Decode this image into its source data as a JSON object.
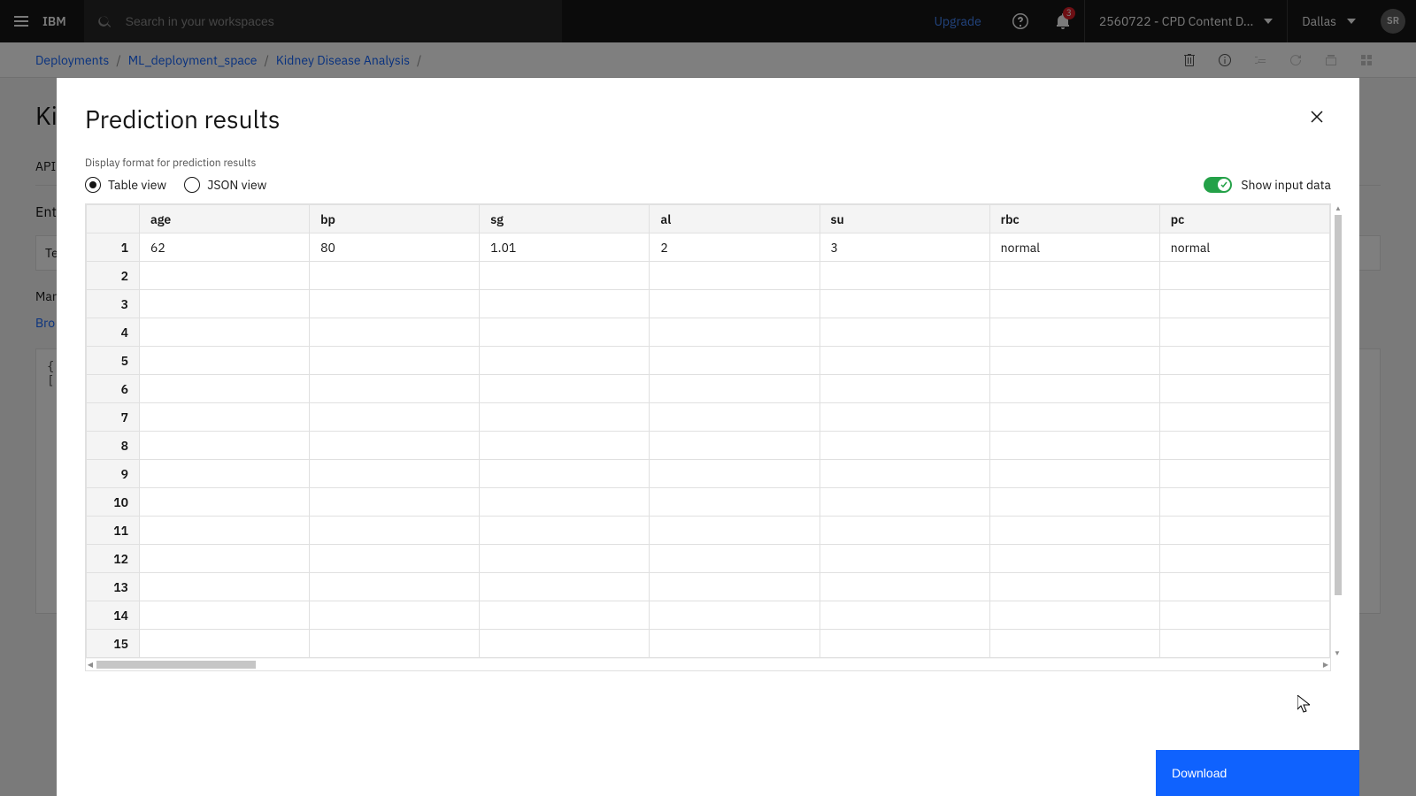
{
  "topbar": {
    "brand": "IBM",
    "search_placeholder": "Search in your workspaces",
    "upgrade": "Upgrade",
    "notif_count": "3",
    "project": "2560722 - CPD Content D...",
    "region": "Dallas",
    "avatar": "SR"
  },
  "breadcrumb": {
    "items": [
      "Deployments",
      "ML_deployment_space",
      "Kidney Disease Analysis"
    ]
  },
  "page": {
    "title_partial": "Ki",
    "tab_partial": "API",
    "enter_partial": "Ente",
    "tex": "Tex",
    "manual": "Mar",
    "browse": "Bro",
    "code1": "{",
    "code2": "["
  },
  "modal": {
    "title": "Prediction results",
    "format_label": "Display format for prediction results",
    "radio_table": "Table view",
    "radio_json": "JSON view",
    "toggle_label": "Show input data",
    "download": "Download",
    "columns": [
      "age",
      "bp",
      "sg",
      "al",
      "su",
      "rbc",
      "pc"
    ],
    "row_count": 15,
    "rows": [
      {
        "age": "62",
        "bp": "80",
        "sg": "1.01",
        "al": "2",
        "su": "3",
        "rbc": "normal",
        "pc": "normal"
      }
    ]
  }
}
